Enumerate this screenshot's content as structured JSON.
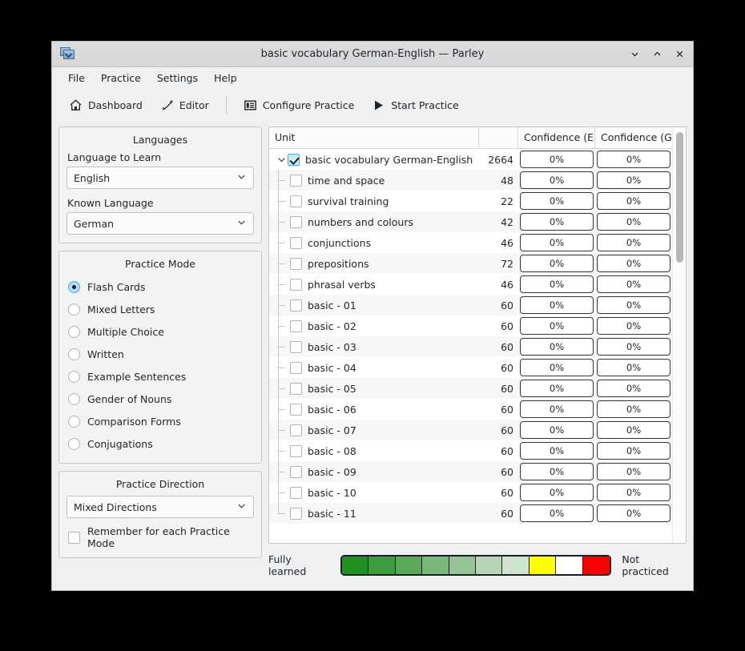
{
  "window": {
    "title": "basic vocabulary German-English — Parley",
    "app_icon": "parley-cards-icon",
    "controls": [
      {
        "name": "minimize-button",
        "glyph": "chevron-down"
      },
      {
        "name": "maximize-button",
        "glyph": "chevron-up"
      },
      {
        "name": "close-button",
        "glyph": "x"
      }
    ]
  },
  "menubar": {
    "items": [
      {
        "label": "File"
      },
      {
        "label": "Practice"
      },
      {
        "label": "Settings"
      },
      {
        "label": "Help"
      }
    ]
  },
  "toolbar": {
    "buttons": [
      {
        "label": "Dashboard",
        "icon": "home-icon"
      },
      {
        "label": "Editor",
        "icon": "pencil-icon"
      },
      {
        "label": "Configure Practice",
        "icon": "configure-list-icon"
      },
      {
        "label": "Start Practice",
        "icon": "play-icon"
      }
    ]
  },
  "languages": {
    "title": "Languages",
    "learn_label": "Language to Learn",
    "learn_value": "English",
    "known_label": "Known Language",
    "known_value": "German"
  },
  "practice_mode": {
    "title": "Practice Mode",
    "options": [
      {
        "label": "Flash Cards",
        "selected": true
      },
      {
        "label": "Mixed Letters",
        "selected": false
      },
      {
        "label": "Multiple Choice",
        "selected": false
      },
      {
        "label": "Written",
        "selected": false
      },
      {
        "label": "Example Sentences",
        "selected": false
      },
      {
        "label": "Gender of Nouns",
        "selected": false
      },
      {
        "label": "Comparison Forms",
        "selected": false
      },
      {
        "label": "Conjugations",
        "selected": false
      }
    ]
  },
  "practice_direction": {
    "title": "Practice Direction",
    "value": "Mixed Directions",
    "remember_label": "Remember for each Practice Mode",
    "remember_checked": false
  },
  "tree": {
    "headers": {
      "unit": "Unit",
      "count": "",
      "confidence_1": "Confidence (E",
      "confidence_2": "Confidence (G"
    },
    "root": {
      "label": "basic vocabulary German-English",
      "count": "2664",
      "checked": true,
      "expanded": true,
      "confidence_1": "0%",
      "confidence_2": "0%"
    },
    "rows": [
      {
        "label": "time and space",
        "count": "48",
        "checked": false,
        "confidence_1": "0%",
        "confidence_2": "0%"
      },
      {
        "label": "survival training",
        "count": "22",
        "checked": false,
        "confidence_1": "0%",
        "confidence_2": "0%"
      },
      {
        "label": "numbers and colours",
        "count": "42",
        "checked": false,
        "confidence_1": "0%",
        "confidence_2": "0%"
      },
      {
        "label": "conjunctions",
        "count": "46",
        "checked": false,
        "confidence_1": "0%",
        "confidence_2": "0%"
      },
      {
        "label": "prepositions",
        "count": "72",
        "checked": false,
        "confidence_1": "0%",
        "confidence_2": "0%"
      },
      {
        "label": "phrasal verbs",
        "count": "46",
        "checked": false,
        "confidence_1": "0%",
        "confidence_2": "0%"
      },
      {
        "label": "basic - 01",
        "count": "60",
        "checked": false,
        "confidence_1": "0%",
        "confidence_2": "0%"
      },
      {
        "label": "basic - 02",
        "count": "60",
        "checked": false,
        "confidence_1": "0%",
        "confidence_2": "0%"
      },
      {
        "label": "basic - 03",
        "count": "60",
        "checked": false,
        "confidence_1": "0%",
        "confidence_2": "0%"
      },
      {
        "label": "basic - 04",
        "count": "60",
        "checked": false,
        "confidence_1": "0%",
        "confidence_2": "0%"
      },
      {
        "label": "basic - 05",
        "count": "60",
        "checked": false,
        "confidence_1": "0%",
        "confidence_2": "0%"
      },
      {
        "label": "basic - 06",
        "count": "60",
        "checked": false,
        "confidence_1": "0%",
        "confidence_2": "0%"
      },
      {
        "label": "basic - 07",
        "count": "60",
        "checked": false,
        "confidence_1": "0%",
        "confidence_2": "0%"
      },
      {
        "label": "basic - 08",
        "count": "60",
        "checked": false,
        "confidence_1": "0%",
        "confidence_2": "0%"
      },
      {
        "label": "basic - 09",
        "count": "60",
        "checked": false,
        "confidence_1": "0%",
        "confidence_2": "0%"
      },
      {
        "label": "basic - 10",
        "count": "60",
        "checked": false,
        "confidence_1": "0%",
        "confidence_2": "0%"
      },
      {
        "label": "basic - 11",
        "count": "60",
        "checked": false,
        "confidence_1": "0%",
        "confidence_2": "0%"
      }
    ]
  },
  "legend": {
    "left_label": "Fully learned",
    "right_label": "Not practiced",
    "colors": [
      "#1e9122",
      "#3f9b3f",
      "#5aa85a",
      "#79b879",
      "#97c497",
      "#b6d6b6",
      "#cfe4cf",
      "#ffff00",
      "#ffffff",
      "#fb0000"
    ]
  }
}
